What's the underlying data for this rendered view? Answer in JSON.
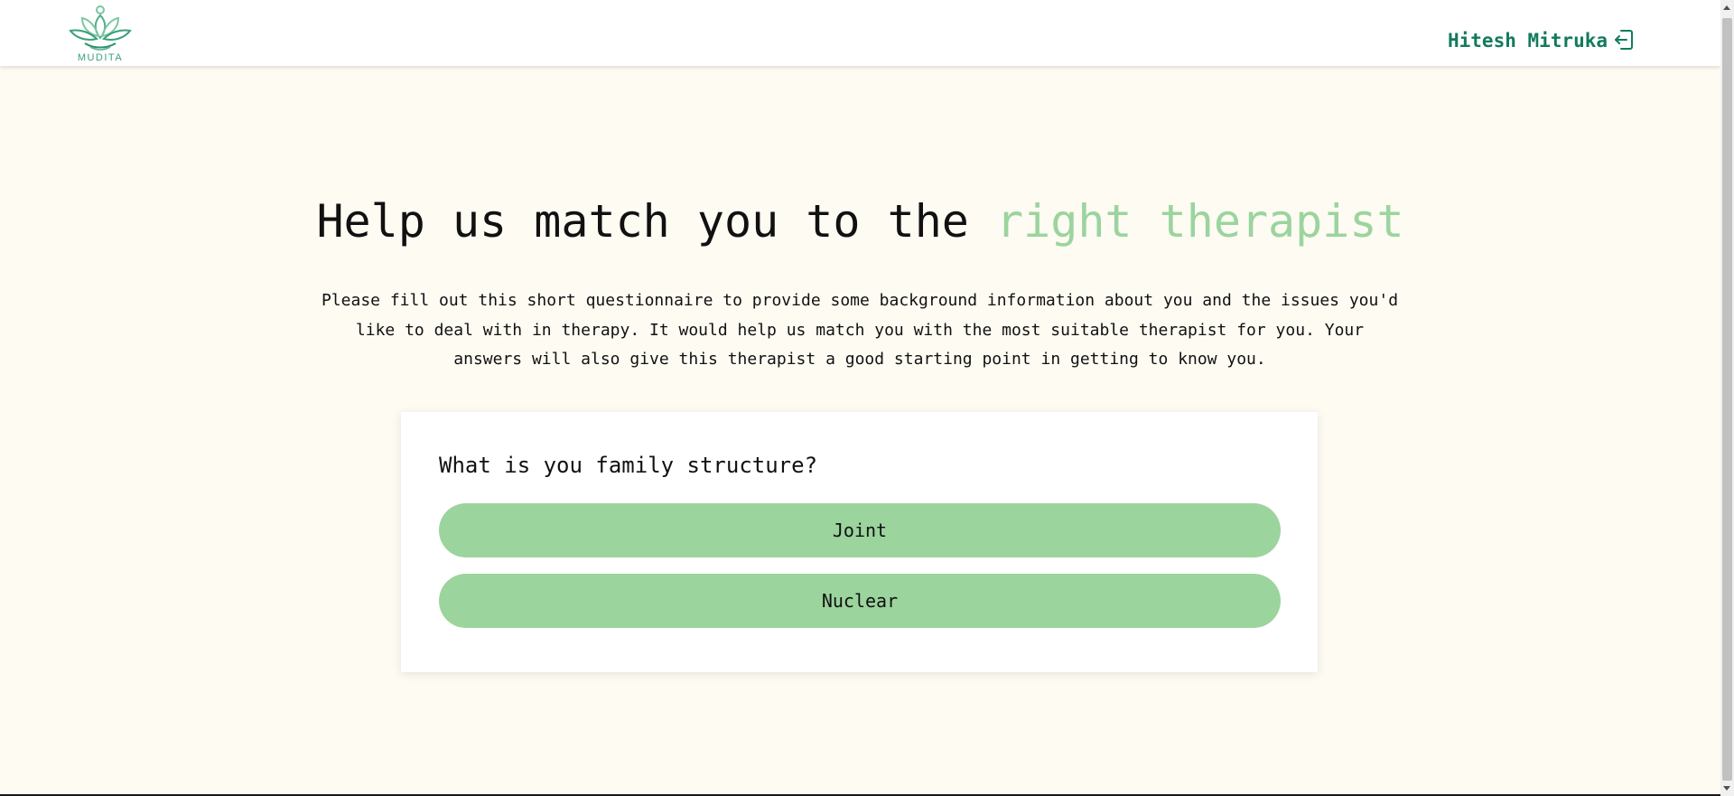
{
  "header": {
    "logo_text": "MUDITA",
    "user_name": "Hitesh Mitruka",
    "logout_icon": "logout-icon"
  },
  "hero": {
    "title_main": "Help us match you to the ",
    "title_accent": "right therapist",
    "description": "Please fill out this short questionnaire to provide some background information about you and the issues you'd like to deal with in therapy. It would help us match you with the most suitable therapist for you. Your answers will also give this therapist a good starting point in getting to know you."
  },
  "questionnaire": {
    "question": "What is you family structure?",
    "options": [
      {
        "label": "Joint"
      },
      {
        "label": "Nuclear"
      }
    ]
  },
  "colors": {
    "background": "#fefbf3",
    "brand_green": "#137a5f",
    "accent_green": "#9bd49e",
    "option_fill": "#9bd49c"
  }
}
